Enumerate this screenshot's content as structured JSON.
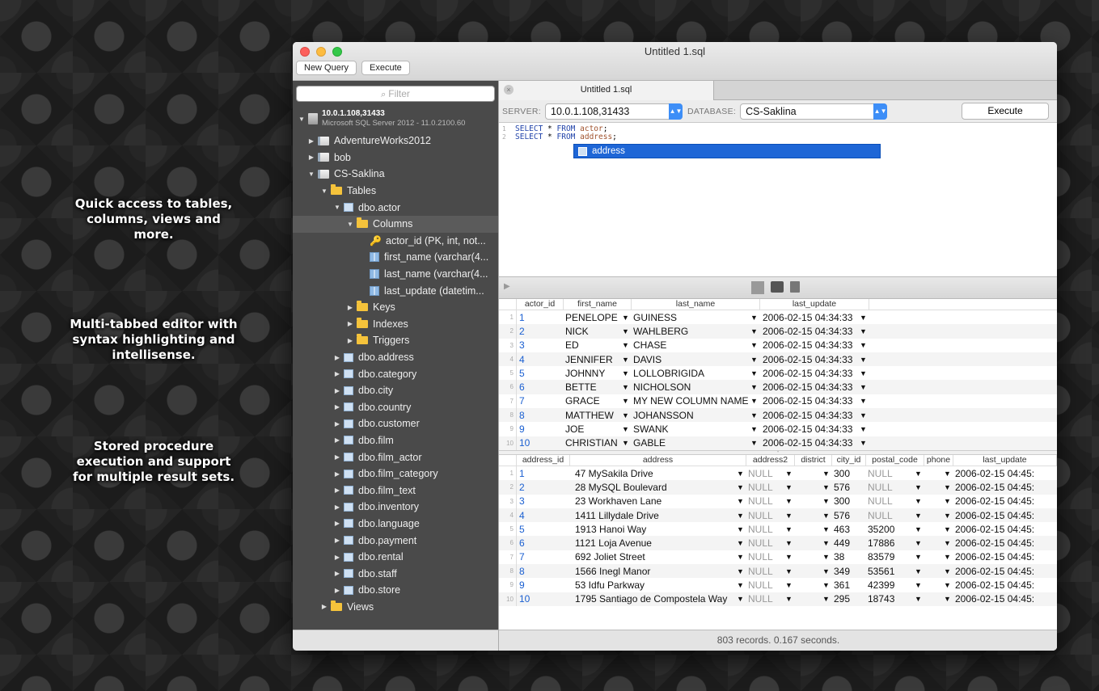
{
  "promo": {
    "line1": "Quick access to tables,",
    "line1b": "columns, views and",
    "line1c": "more.",
    "line2": "Multi-tabbed editor with",
    "line2b": "syntax highlighting and",
    "line2c": "intellisense.",
    "line3": "Stored procedure",
    "line3b": "execution and support",
    "line3c": "for multiple result sets."
  },
  "window": {
    "title": "Untitled 1.sql",
    "new_query": "New Query",
    "execute": "Execute"
  },
  "sidebar": {
    "filter_placeholder": "Filter",
    "server_name": "10.0.1.108,31433",
    "server_version": "Microsoft SQL Server 2012 - 11.0.2100.60",
    "items": [
      {
        "label": "AdventureWorks2012"
      },
      {
        "label": "bob"
      },
      {
        "label": "CS-Saklina"
      },
      {
        "label": "Tables"
      },
      {
        "label": "dbo.actor"
      },
      {
        "label": "Columns"
      },
      {
        "label": "actor_id (PK, int, not..."
      },
      {
        "label": "first_name (varchar(4..."
      },
      {
        "label": "last_name (varchar(4..."
      },
      {
        "label": "last_update (datetim..."
      },
      {
        "label": "Keys"
      },
      {
        "label": "Indexes"
      },
      {
        "label": "Triggers"
      },
      {
        "label": "dbo.address"
      },
      {
        "label": "dbo.category"
      },
      {
        "label": "dbo.city"
      },
      {
        "label": "dbo.country"
      },
      {
        "label": "dbo.customer"
      },
      {
        "label": "dbo.film"
      },
      {
        "label": "dbo.film_actor"
      },
      {
        "label": "dbo.film_category"
      },
      {
        "label": "dbo.film_text"
      },
      {
        "label": "dbo.inventory"
      },
      {
        "label": "dbo.language"
      },
      {
        "label": "dbo.payment"
      },
      {
        "label": "dbo.rental"
      },
      {
        "label": "dbo.staff"
      },
      {
        "label": "dbo.store"
      },
      {
        "label": "Views"
      }
    ]
  },
  "editor": {
    "tab_label": "Untitled 1.sql",
    "server_label": "SERVER:",
    "server_value": "10.0.1.108,31433",
    "database_label": "DATABASE:",
    "database_value": "CS-Saklina",
    "execute_label": "Execute",
    "line1_num": "1",
    "line2_num": "2",
    "kw_select": "SELECT",
    "star": " * ",
    "kw_from": "FROM",
    "line1_table": "actor",
    "line2_table": "address",
    "semicolon": ";",
    "autocomplete": "address"
  },
  "result1": {
    "columns": [
      "actor_id",
      "first_name",
      "last_name",
      "last_update"
    ],
    "rows": [
      [
        "1",
        "1",
        "PENELOPE",
        "GUINESS",
        "2006-02-15 04:34:33"
      ],
      [
        "2",
        "2",
        "NICK",
        "WAHLBERG",
        "2006-02-15 04:34:33"
      ],
      [
        "3",
        "3",
        "ED",
        "CHASE",
        "2006-02-15 04:34:33"
      ],
      [
        "4",
        "4",
        "JENNIFER",
        "DAVIS",
        "2006-02-15 04:34:33"
      ],
      [
        "5",
        "5",
        "JOHNNY",
        "LOLLOBRIGIDA",
        "2006-02-15 04:34:33"
      ],
      [
        "6",
        "6",
        "BETTE",
        "NICHOLSON",
        "2006-02-15 04:34:33"
      ],
      [
        "7",
        "7",
        "GRACE",
        "MY NEW COLUMN NAME",
        "2006-02-15 04:34:33"
      ],
      [
        "8",
        "8",
        "MATTHEW",
        "JOHANSSON",
        "2006-02-15 04:34:33"
      ],
      [
        "9",
        "9",
        "JOE",
        "SWANK",
        "2006-02-15 04:34:33"
      ],
      [
        "10",
        "10",
        "CHRISTIAN",
        "GABLE",
        "2006-02-15 04:34:33"
      ]
    ]
  },
  "result2": {
    "columns": [
      "address_id",
      "address",
      "address2",
      "district",
      "city_id",
      "postal_code",
      "phone",
      "last_update"
    ],
    "rows": [
      [
        "1",
        "1",
        "47 MySakila Drive",
        "NULL",
        "",
        "300",
        "NULL",
        "",
        "2006-02-15 04:45:"
      ],
      [
        "2",
        "2",
        "28 MySQL Boulevard",
        "NULL",
        "",
        "576",
        "NULL",
        "",
        "2006-02-15 04:45:"
      ],
      [
        "3",
        "3",
        "23 Workhaven Lane",
        "NULL",
        "",
        "300",
        "NULL",
        "",
        "2006-02-15 04:45:"
      ],
      [
        "4",
        "4",
        "1411 Lillydale Drive",
        "NULL",
        "",
        "576",
        "NULL",
        "",
        "2006-02-15 04:45:"
      ],
      [
        "5",
        "5",
        "1913 Hanoi Way",
        "NULL",
        "",
        "463",
        "35200",
        "",
        "2006-02-15 04:45:"
      ],
      [
        "6",
        "6",
        "1121 Loja Avenue",
        "NULL",
        "",
        "449",
        "17886",
        "",
        "2006-02-15 04:45:"
      ],
      [
        "7",
        "7",
        "692 Joliet Street",
        "NULL",
        "",
        "38",
        "83579",
        "",
        "2006-02-15 04:45:"
      ],
      [
        "8",
        "8",
        "1566 Inegl Manor",
        "NULL",
        "",
        "349",
        "53561",
        "",
        "2006-02-15 04:45:"
      ],
      [
        "9",
        "9",
        "53 Idfu Parkway",
        "NULL",
        "",
        "361",
        "42399",
        "",
        "2006-02-15 04:45:"
      ],
      [
        "10",
        "10",
        "1795 Santiago de Compostela Way",
        "NULL",
        "",
        "295",
        "18743",
        "",
        "2006-02-15 04:45:"
      ]
    ]
  },
  "status": "803 records. 0.167 seconds.",
  "icons": {
    "dropdown": "▼",
    "expanded": "▼",
    "collapsed": "▶",
    "key": "🔑",
    "search": "⌕"
  },
  "colors": {
    "selection": "#1e66d6",
    "keyword": "#2244aa",
    "accent": "#3d8ef7"
  }
}
